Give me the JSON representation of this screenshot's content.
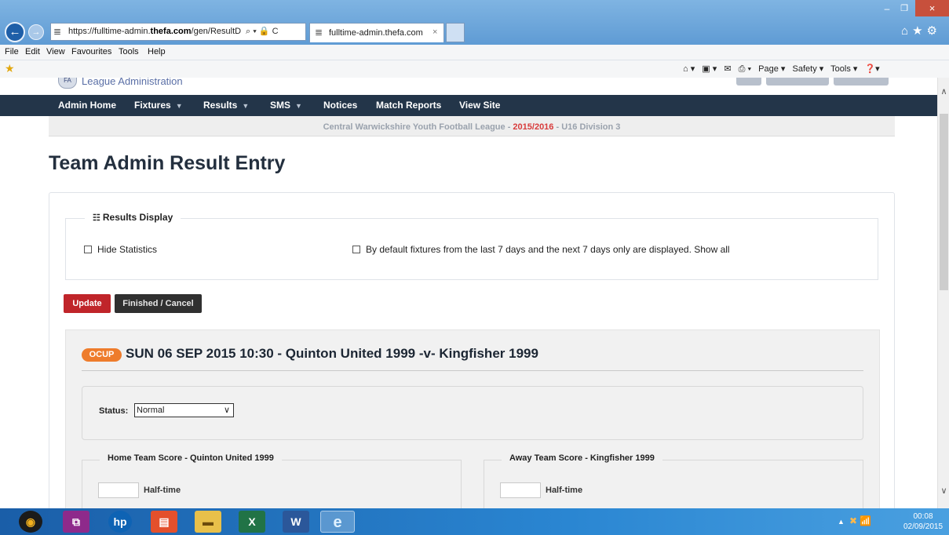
{
  "browser": {
    "url": "https://fulltime-admin.thefa.com/gen/ResultDirec",
    "url_parts": {
      "prefix": "https://fulltime-admin.",
      "host": "thefa.com",
      "suffix": "/gen/ResultDirec"
    },
    "address_actions": "⌕ ▾ 🔒 C",
    "tab_title": "fulltime-admin.thefa.com",
    "tab_close": "×",
    "menu": [
      "File",
      "Edit",
      "View",
      "Favourites",
      "Tools",
      "Help"
    ],
    "commands": [
      "Page ▾",
      "Safety ▾",
      "Tools ▾"
    ],
    "window_controls": {
      "minimize": "–",
      "maximize": "❐",
      "close": "×"
    }
  },
  "site": {
    "header_title": "League Administration",
    "nav": [
      {
        "label": "Admin Home",
        "dropdown": false
      },
      {
        "label": "Fixtures",
        "dropdown": true
      },
      {
        "label": "Results",
        "dropdown": true
      },
      {
        "label": "SMS",
        "dropdown": true
      },
      {
        "label": "Notices",
        "dropdown": false
      },
      {
        "label": "Match Reports",
        "dropdown": false
      },
      {
        "label": "View Site",
        "dropdown": false
      }
    ],
    "league_strip": {
      "league": "Central Warwickshire Youth Football League",
      "separator": " - ",
      "season": "2015/2016",
      "division": "U16 Division 3"
    }
  },
  "page": {
    "title": "Team Admin Result Entry",
    "results_display": {
      "legend": "Results Display",
      "hide_statistics": {
        "label": "Hide Statistics",
        "checked": false
      },
      "show_all": {
        "label": "By default fixtures from the last 7 days and the next 7 days only are displayed. Show all",
        "checked": false
      }
    },
    "buttons": {
      "update": "Update",
      "finish": "Finished / Cancel"
    },
    "fixture": {
      "badge": "OCUP",
      "title": "SUN 06 SEP 2015 10:30 - Quinton United 1999 -v- Kingfisher 1999",
      "status_label": "Status:",
      "status_value": "Normal",
      "home": {
        "legend": "Home Team Score - Quinton United 1999",
        "half_time_label": "Half-time",
        "half_time_value": ""
      },
      "away": {
        "legend": "Away Team Score - Kingfisher 1999",
        "half_time_label": "Half-time",
        "half_time_value": ""
      }
    }
  },
  "taskbar": {
    "apps": [
      "media-player",
      "remote-app",
      "hp",
      "office",
      "file-explorer",
      "excel",
      "word",
      "internet-explorer"
    ],
    "clock_time": "00:08",
    "clock_date": "02/09/2015"
  },
  "colors": {
    "navbar": "#233549",
    "update_button": "#c0252a",
    "finish_button": "#303030",
    "badge": "#ee7c2c",
    "season": "#d83b3b"
  }
}
